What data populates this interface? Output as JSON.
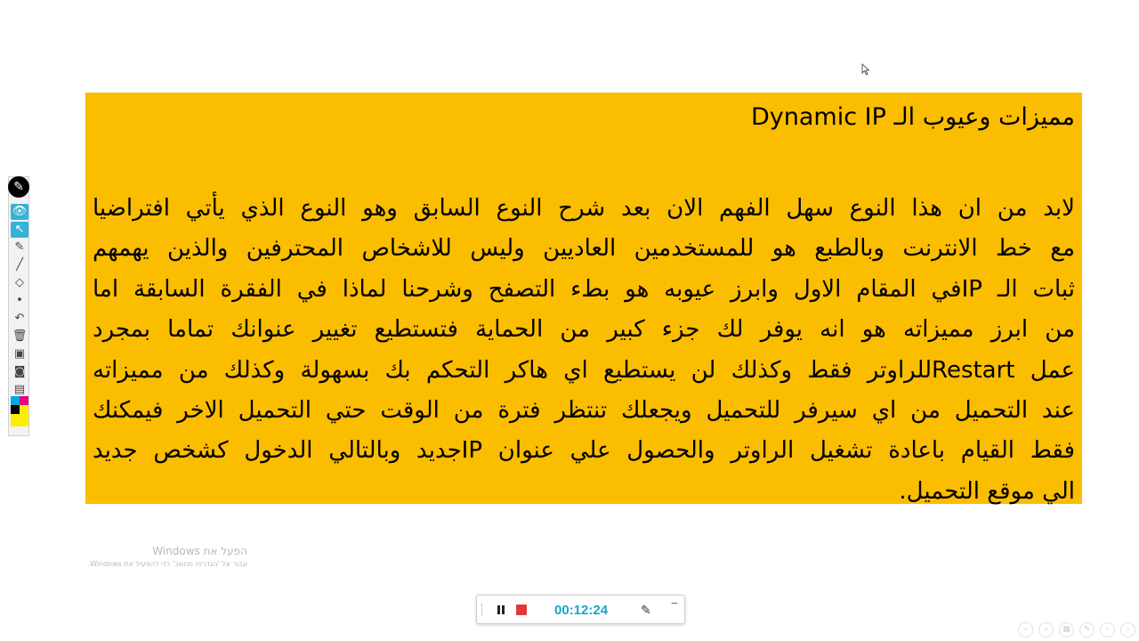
{
  "slide": {
    "title": "مميزات وعيوب الـ Dynamic IP",
    "background_color": "#fbbd00",
    "body_lines": [
      "لابد من ان هذا النوع سهل الفهم الان بعد شرح النوع السابق وهو النوع الذي يأتي افتراضيا",
      "مع خط الانترنت وبالطبع هو للمستخدمين العاديين وليس للاشخاص المحترفين والذين يهمهم",
      "ثبات الـ IPفي المقام الاول وابرز عيوبه هو بطء التصفح وشرحنا لماذا في الفقرة السابقة اما",
      "من ابرز مميزاته هو انه يوفر لك جزء كبير من الحماية فتستطيع تغيير عنوانك تماما بمجرد",
      "عمل Restartللراوتر فقط وكذلك لن يستطيع اي هاكر التحكم بك بسهولة وكذلك من مميزاته",
      "عند التحميل من اي سيرفر للتحميل ويجعلك تنتظر فترة من الوقت حتي التحميل الاخر فيمكنك",
      "فقط القيام باعادة تشغيل الراوتر والحصول علي عنوان IPجديد وبالتالي الدخول كشخص جديد",
      "الي موقع التحميل."
    ]
  },
  "watermark": {
    "title": "הפעל את Windows",
    "subtitle": "עבור אל 'הגדרות מחשב' כדי להפעיל את Windows."
  },
  "recorder": {
    "timer": "00:12:24",
    "accent_color": "#1aa3c9",
    "stop_color": "#e0393a"
  },
  "toolbar": {
    "tools": [
      "logo-icon",
      "eye-icon",
      "pointer-icon",
      "pen-icon",
      "line-icon",
      "eraser-icon",
      "dot-icon",
      "undo-icon",
      "trash-icon",
      "screen-icon",
      "camera-icon",
      "clipboard-icon"
    ],
    "swatch_colors": [
      "#00a9e0",
      "#e6007e",
      "#000000",
      "#ffed00"
    ]
  },
  "slide_controls": [
    "zoom-out-icon",
    "zoom-in-icon",
    "grid-icon",
    "pen-icon",
    "prev-icon",
    "next-icon"
  ]
}
